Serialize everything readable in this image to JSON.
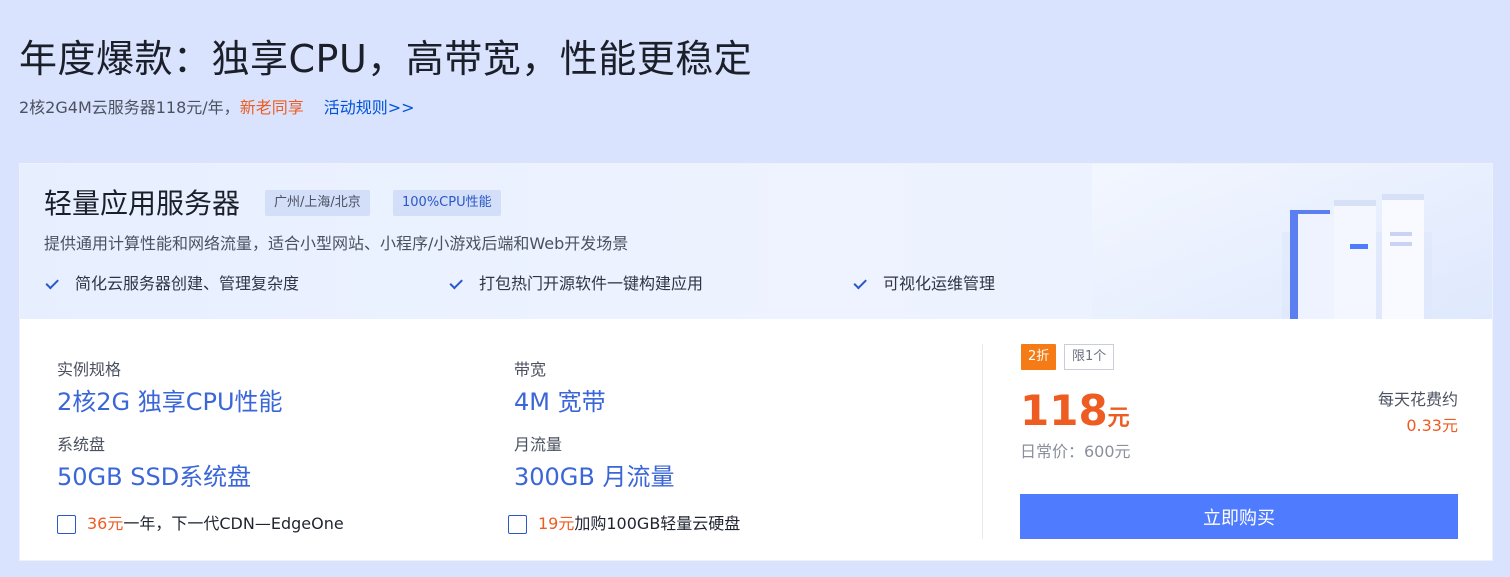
{
  "hero": {
    "title": "年度爆款：独享CPU，高带宽，性能更稳定",
    "sub_text": "2核2G4M云服务器118元/年，",
    "sub_highlight": "新老同享",
    "rules_link": "活动规则>>"
  },
  "product": {
    "name": "轻量应用服务器",
    "tags": [
      "广州/上海/北京",
      "100%CPU性能"
    ],
    "description": "提供通用计算性能和网络流量，适合小型网站、小程序/小游戏后端和Web开发场景",
    "features": [
      "简化云服务器创建、管理复杂度",
      "打包热门开源软件一键构建应用",
      "可视化运维管理"
    ]
  },
  "specs": [
    {
      "label": "实例规格",
      "value": "2核2G 独享CPU性能"
    },
    {
      "label": "带宽",
      "value": "4M 宽带"
    },
    {
      "label": "系统盘",
      "value": "50GB SSD系统盘"
    },
    {
      "label": "月流量",
      "value": "300GB 月流量"
    }
  ],
  "addons": [
    {
      "price": "36元",
      "text": "一年，下一代CDN—EdgeOne"
    },
    {
      "price": "19元",
      "text": "加购100GB轻量云硬盘"
    }
  ],
  "purchase": {
    "discount_badge": "2折",
    "limit_badge": "限1个",
    "price": "118",
    "price_unit": "元",
    "original_price": "日常价：600元",
    "daily_label": "每天花费约",
    "daily_value": "0.33元",
    "buy_label": "立即购买"
  },
  "colors": {
    "accent": "#4f7bff",
    "price": "#ee5c22",
    "link": "#0052d9",
    "spec_value": "#3a66d8",
    "page_bg": "#d9e3fd"
  }
}
